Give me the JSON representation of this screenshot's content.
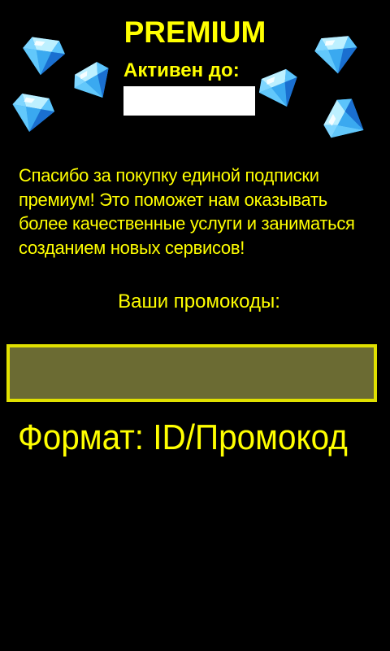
{
  "header": {
    "title": "PREMIUM",
    "active_until_label": "Активен до:",
    "active_until_value": ""
  },
  "message": {
    "thanks_text": "Спасибо за покупку единой подписки премиум! Это поможет нам оказывать более качественные услуги и заниматься созданием новых сервисов!"
  },
  "promo": {
    "label": "Ваши промокоды:",
    "value": "",
    "format_text": "Формат: ID/Промокод"
  },
  "decor": {
    "icon": "diamond-icon",
    "count": 7
  },
  "colors": {
    "background": "#000000",
    "text_accent": "#ffff00",
    "promo_field_fill": "#6b6b33",
    "promo_field_border": "#e0e000",
    "date_field_fill": "#ffffff",
    "gem_light": "#8fe0ff",
    "gem_mid": "#3aa9f0",
    "gem_dark": "#1a6fd0"
  }
}
